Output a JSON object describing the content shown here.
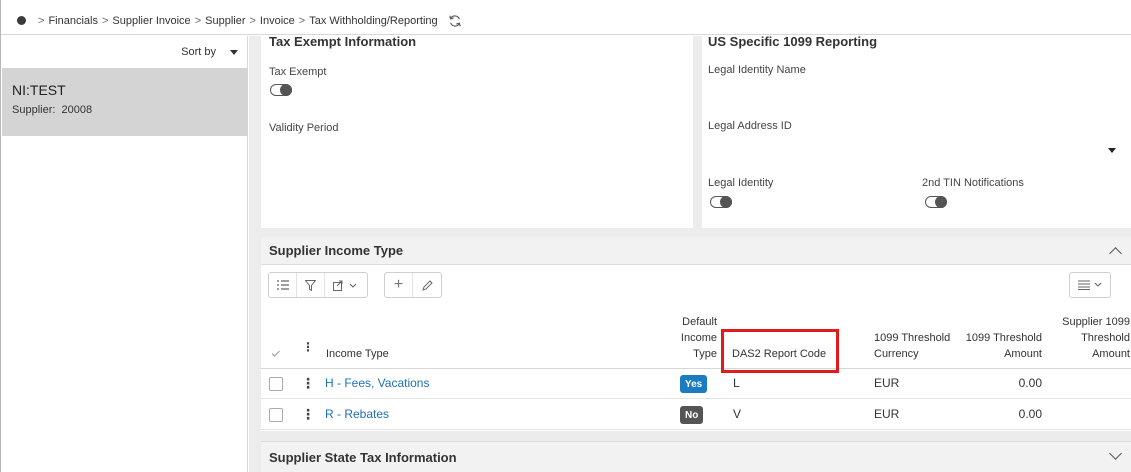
{
  "breadcrumb": {
    "items": [
      "Financials",
      "Supplier Invoice",
      "Supplier",
      "Invoice",
      "Tax Withholding/Reporting"
    ]
  },
  "left_panel": {
    "sort_label": "Sort by",
    "record": {
      "name": "NI:TEST",
      "sub_label": "Supplier:",
      "sub_value": "20008"
    }
  },
  "tax_exempt_card": {
    "title": "Tax Exempt Information",
    "tax_exempt_label": "Tax Exempt",
    "validity_label": "Validity Period"
  },
  "us_1099_card": {
    "title": "US Specific 1099 Reporting",
    "legal_identity_name_label": "Legal Identity Name",
    "legal_address_label": "Legal Address ID",
    "legal_identity_label": "Legal Identity",
    "tin_label": "2nd TIN Notifications"
  },
  "income_section": {
    "title": "Supplier Income Type",
    "columns": {
      "income_type": "Income Type",
      "default_l1": "Default",
      "default_l2": "Income",
      "default_l3": "Type",
      "das2": "DAS2 Report Code",
      "cur_l1": "1099 Threshold",
      "cur_l2": "Currency",
      "amt_l1": "1099 Threshold",
      "amt_l2": "Amount",
      "sup_l1": "Supplier 1099",
      "sup_l2": "Threshold",
      "sup_l3": "Amount"
    },
    "rows": [
      {
        "income_type": "H - Fees, Vacations",
        "default": "Yes",
        "das2": "L",
        "currency": "EUR",
        "amount": "0.00"
      },
      {
        "income_type": "R - Rebates",
        "default": "No",
        "das2": "V",
        "currency": "EUR",
        "amount": "0.00"
      }
    ]
  },
  "state_section": {
    "title": "Supplier State Tax Information"
  },
  "colors": {
    "link": "#1e6fb8",
    "yes_badge": "#1a7dc2",
    "no_badge": "#555555",
    "highlight": "#e01b1b"
  }
}
